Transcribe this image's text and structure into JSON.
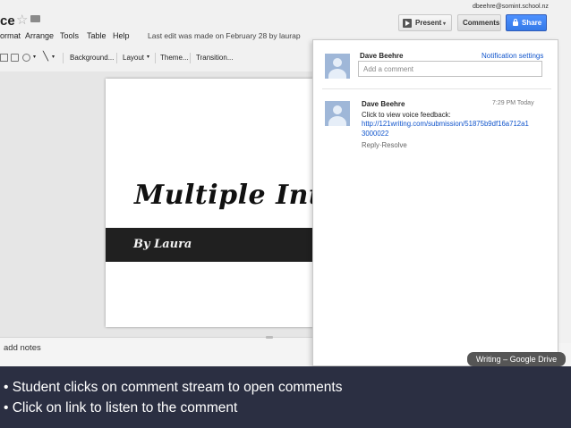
{
  "header": {
    "doc_title": "ce",
    "star_icon": "☆",
    "user_email": "dbeehre@somint.school.nz",
    "last_edit": "Last edit was made on February 28 by laurap",
    "present_label": "Present",
    "dropdown_arrow": "▾",
    "comments_label": "Comments",
    "share_label": "Share"
  },
  "menu": [
    {
      "label": "ormat"
    },
    {
      "label": "Arrange"
    },
    {
      "label": "Tools"
    },
    {
      "label": "Table"
    },
    {
      "label": "Help"
    }
  ],
  "toolbar": {
    "dropdown_arrow": "▾",
    "line_glyph": "╲",
    "background_label": "Background...",
    "layout_label": "Layout",
    "theme_label": "Theme...",
    "transition_label": "Transition..."
  },
  "slide": {
    "title": "Multiple Intelli",
    "subtitle": "By Laura"
  },
  "notes": {
    "placeholder": "add notes"
  },
  "comments_panel": {
    "user_name": "Dave Beehre",
    "notification_settings": "Notification settings",
    "add_comment_placeholder": "Add a comment",
    "comment": {
      "author": "Dave Beehre",
      "time": "7:29 PM Today",
      "text": "Click to view voice feedback:",
      "link_line1": "http://121writing.com/submission/51875b9df16a712a1",
      "link_line2": "3000022",
      "reply": "Reply",
      "separator": "·",
      "resolve": "Resolve"
    }
  },
  "tooltip": "Writing – Google Drive",
  "caption": {
    "line1": "• Student clicks on comment stream to open comments",
    "line2": "• Click on link to listen to the comment"
  },
  "colors": {
    "share_blue": "#4d90fe",
    "link_blue": "#1155cc",
    "caption_bg": "#2b2f42",
    "slide_band": "#202020"
  }
}
